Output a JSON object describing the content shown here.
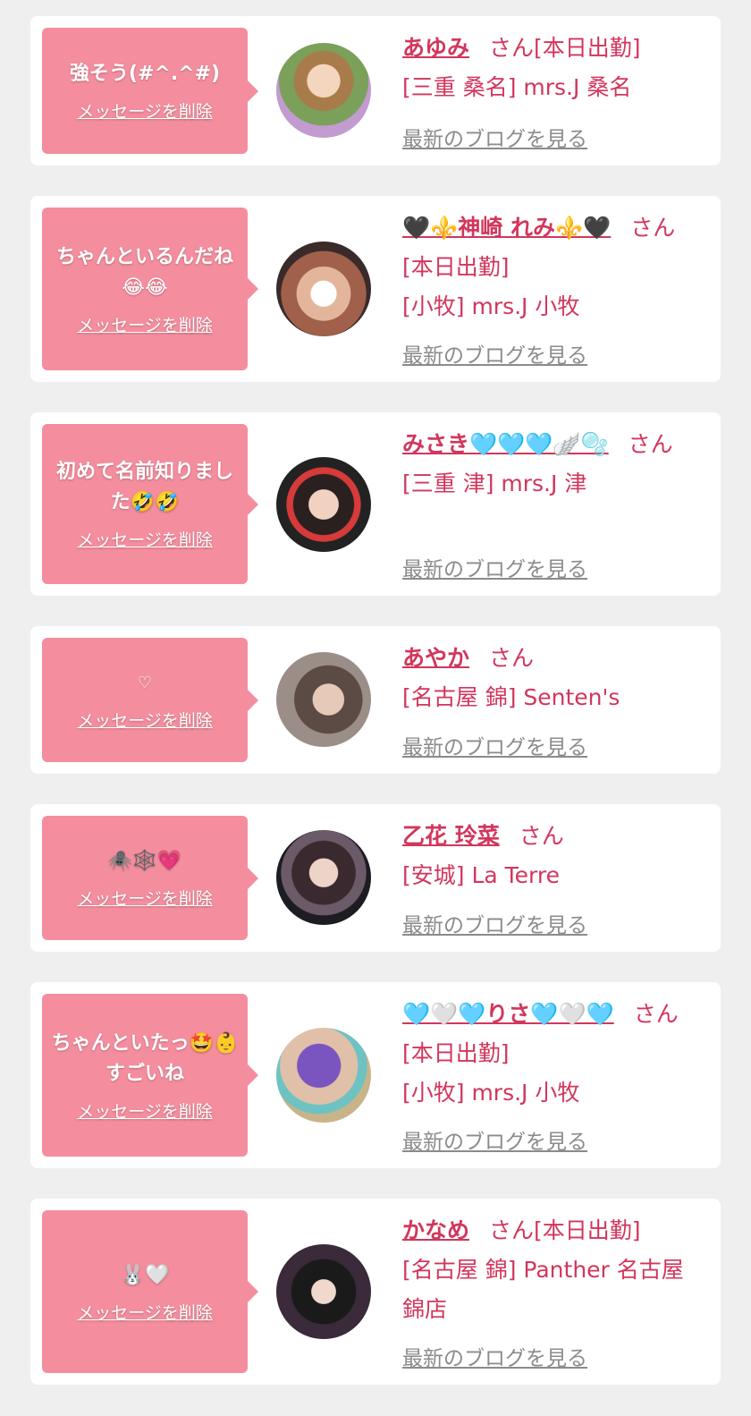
{
  "colors": {
    "accent": "#d2365c",
    "bubble": "#f48e9e",
    "page_bg": "#efeff0",
    "card_bg": "#ffffff",
    "blog_link": "#8b8b8b"
  },
  "delete_label": "メッセージを削除",
  "blog_label": "最新のブログを見る",
  "items": [
    {
      "message": "強そう(#^.^#)",
      "name": "あゆみ",
      "suffix": "さん[本日出勤]",
      "shop": "[三重 桑名] mrs.J 桑名",
      "avatar_icon": "avatar-photo"
    },
    {
      "message": "ちゃんといるんだね😂😂",
      "name": "🖤⚜️神崎 れみ⚜️🖤",
      "suffix": "さん[本日出勤]",
      "shop": "[小牧] mrs.J 小牧",
      "avatar_icon": "avatar-photo"
    },
    {
      "message": "初めて名前知りました🤣🤣",
      "name": "みさき🩵🩵🩵🪽🫧",
      "suffix": "さん",
      "shop": "[三重 津] mrs.J 津",
      "avatar_icon": "avatar-photo"
    },
    {
      "message": "♡",
      "name": "あやか",
      "suffix": "さん",
      "shop": "[名古屋 錦] Senten's",
      "avatar_icon": "avatar-photo"
    },
    {
      "message": "🕷️🕸️💗",
      "name": "乙花 玲菜",
      "suffix": "さん",
      "shop": "[安城] La Terre",
      "avatar_icon": "avatar-photo"
    },
    {
      "message": "ちゃんといたっ🤩👶すごいね",
      "name": "🩵🤍🩵りさ🩵🤍🩵",
      "suffix": "さん[本日出勤]",
      "shop": "[小牧] mrs.J 小牧",
      "avatar_icon": "avatar-photo"
    },
    {
      "message": "🐰🤍",
      "name": "かなめ",
      "suffix": "さん[本日出勤]",
      "shop": "[名古屋 錦] Panther 名古屋錦店",
      "avatar_icon": "avatar-photo"
    }
  ]
}
